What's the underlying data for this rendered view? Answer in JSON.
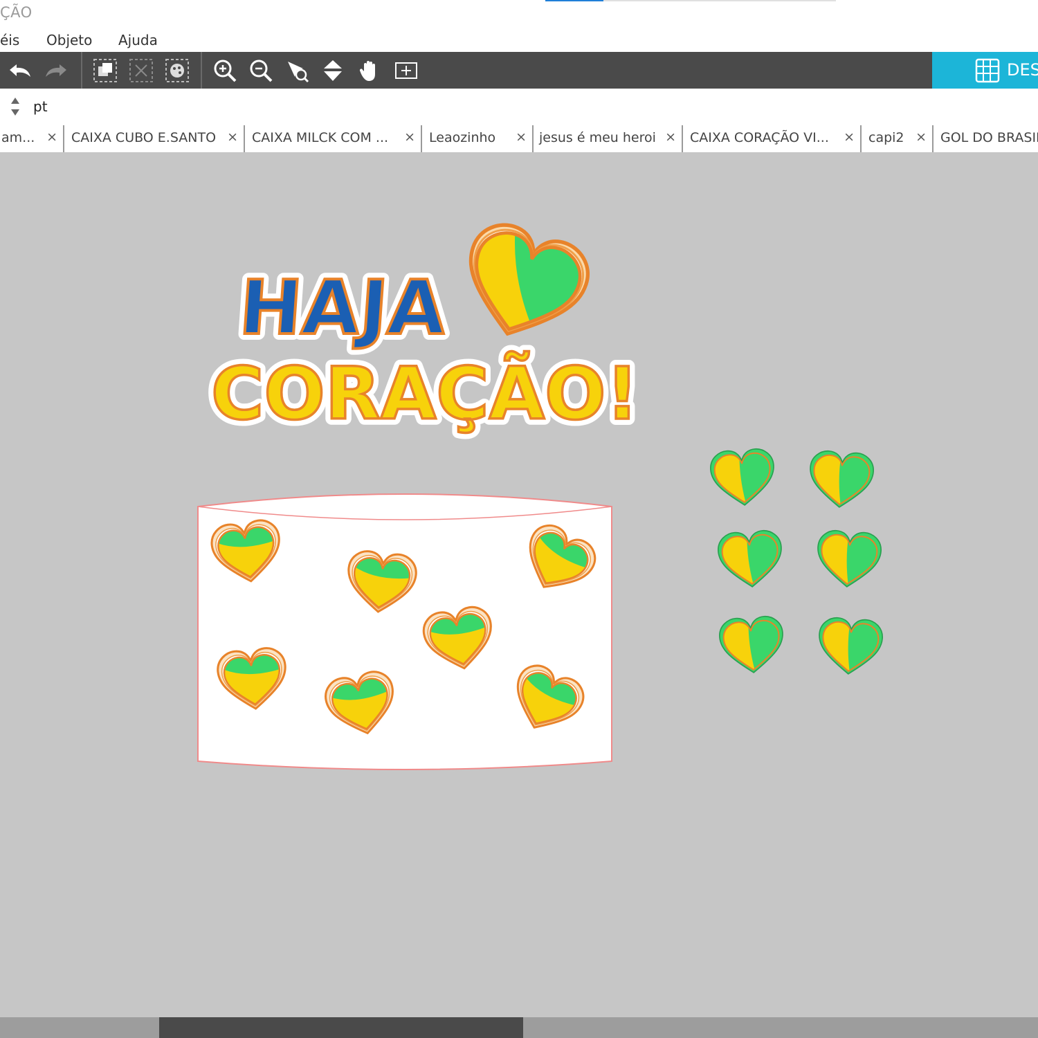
{
  "window": {
    "title_fragment": "ÇÃO"
  },
  "menu": {
    "items": [
      "éis",
      "Objeto",
      "Ajuda"
    ]
  },
  "toolbar": {
    "tools": [
      "undo-icon",
      "redo-icon",
      "group-icon",
      "ungroup-icon",
      "fill-icon",
      "zoom-in-icon",
      "zoom-out-icon",
      "zoom-select-icon",
      "move-down-icon",
      "pan-hand-icon",
      "fit-page-icon"
    ],
    "design_label": "DES",
    "design_color": "#1cb5d8"
  },
  "unit": {
    "label": "pt"
  },
  "tabs": [
    {
      "label": "am...",
      "close": "×"
    },
    {
      "label": "CAIXA CUBO E.SANTO",
      "close": "×"
    },
    {
      "label": "CAIXA MILCK COM ...",
      "close": "×"
    },
    {
      "label": "Leaozinho",
      "close": "×"
    },
    {
      "label": "jesus é meu heroi",
      "close": "×"
    },
    {
      "label": "CAIXA CORAÇÃO VI...",
      "close": "×"
    },
    {
      "label": "capi2",
      "close": "×"
    },
    {
      "label": "GOL DO BRASIL",
      "close": ""
    }
  ],
  "canvas": {
    "artwork_title_line1": "HAJA",
    "artwork_title_line2": "CORAÇÃO!",
    "colors": {
      "green": "#3ad66a",
      "yellow": "#f7d20b",
      "blue": "#1b5fb3",
      "orange": "#e8832a",
      "cut_line": "#f08a8a"
    }
  }
}
